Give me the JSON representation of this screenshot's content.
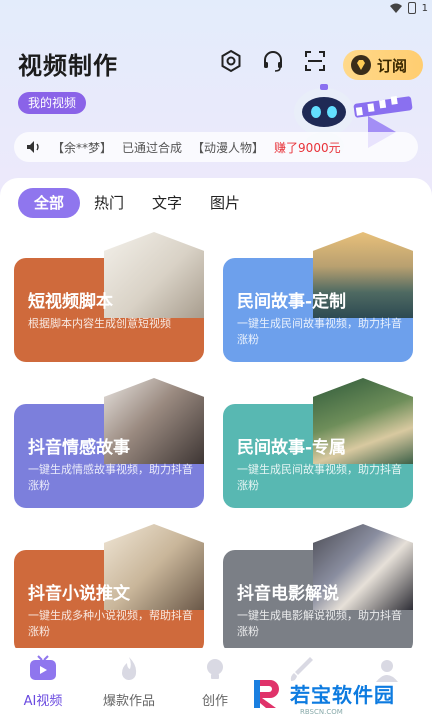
{
  "status": {
    "time": "1"
  },
  "header": {
    "title": "视频制作",
    "subscribe_label": "订阅",
    "my_video_label": "我的视频"
  },
  "ticker": {
    "user": "【余**梦】",
    "action": "已通过合成",
    "project": "【动漫人物】",
    "earning": "赚了9000元"
  },
  "tabs": [
    {
      "label": "全部",
      "active": true
    },
    {
      "label": "热门"
    },
    {
      "label": "文字"
    },
    {
      "label": "图片"
    }
  ],
  "cards": [
    {
      "title": "短视频脚本",
      "desc": "根据脚本内容生成创意短视频",
      "color": "#cf6a3c"
    },
    {
      "title": "民间故事-定制",
      "desc": "一键生成民间故事视频，助力抖音涨粉",
      "color": "#6da0ec"
    },
    {
      "title": "抖音情感故事",
      "desc": "一键生成情感故事视频，助力抖音涨粉",
      "color": "#7c7fdc"
    },
    {
      "title": "民间故事-专属",
      "desc": "一键生成民间故事视频，助力抖音涨粉",
      "color": "#58b8b2"
    },
    {
      "title": "抖音小说推文",
      "desc": "一键生成多种小说视频，帮助抖音涨粉",
      "color": "#cf6a3c"
    },
    {
      "title": "抖音电影解说",
      "desc": "一键生成电影解说视频，助力抖音涨粉",
      "color": "#7b7f86"
    }
  ],
  "nav": [
    {
      "label": "AI视频",
      "active": true,
      "icon": "tv-icon"
    },
    {
      "label": "爆款作品",
      "icon": "flame-icon"
    },
    {
      "label": "创作",
      "icon": "bulb-icon"
    },
    {
      "label": "",
      "icon": "brush-icon"
    },
    {
      "label": "",
      "icon": "profile-icon"
    }
  ],
  "watermark": {
    "text": "若宝软件园",
    "sub": "RBSCN.COM"
  },
  "colors": {
    "accent": "#8f76ee",
    "brand_purple": "#6a4ae0",
    "earn_red": "#e8333a",
    "subscribe_gold": "#ffd27a"
  }
}
